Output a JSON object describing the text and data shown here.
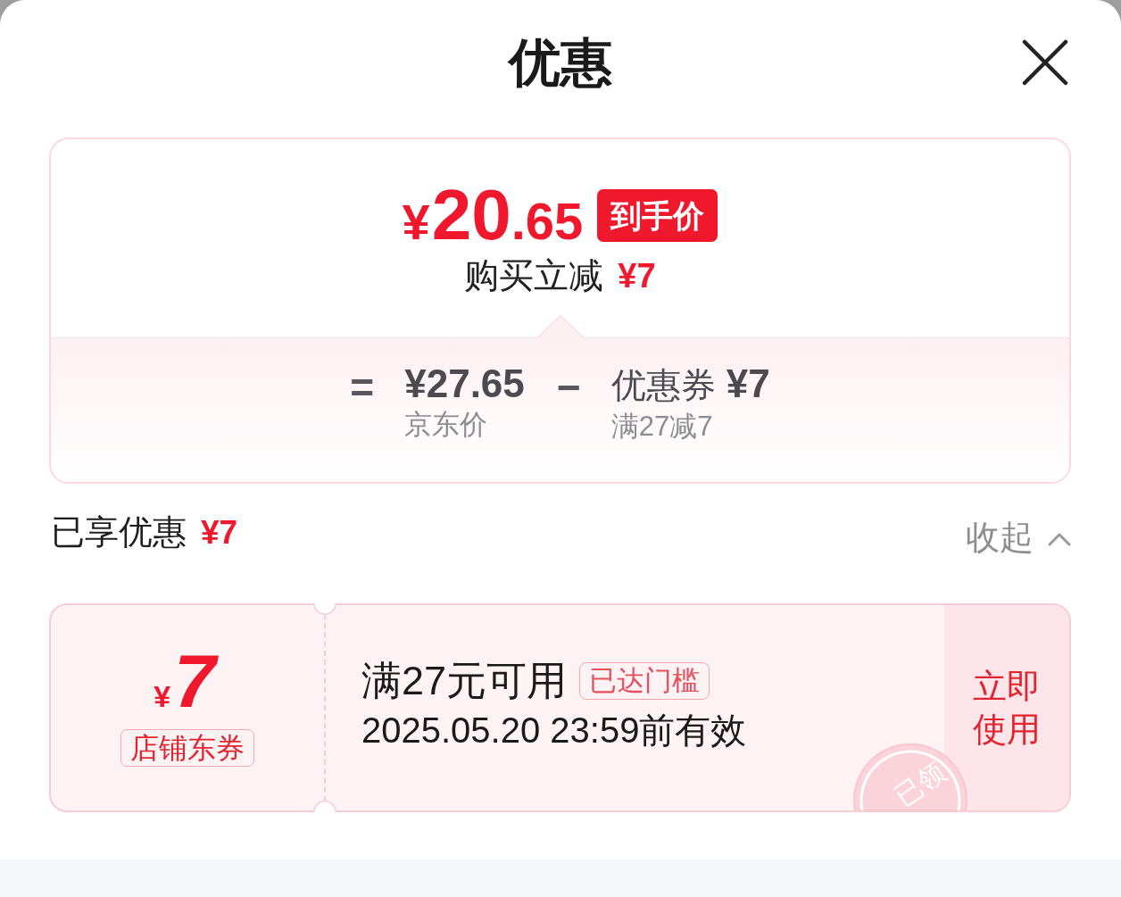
{
  "header": {
    "title": "优惠"
  },
  "price_card": {
    "final_price": {
      "currency": "¥",
      "integer": "20",
      "fraction": ".65"
    },
    "price_badge": "到手价",
    "instant_discount": {
      "label": "购买立减",
      "amount": "¥7"
    },
    "breakdown": {
      "equals_sign": "=",
      "original": {
        "amount": "¥27.65",
        "label": "京东价"
      },
      "minus_sign": "−",
      "coupon": {
        "label": "优惠券",
        "amount": "¥7",
        "condition": "满27减7"
      }
    }
  },
  "applied_discount": {
    "label": "已享优惠",
    "amount": "¥7",
    "toggle": {
      "label": "收起",
      "expanded": true
    }
  },
  "coupons": [
    {
      "currency": "¥",
      "amount": "7",
      "type": "店铺东券",
      "condition": "满27元可用",
      "threshold_tag": "已达门槛",
      "validity": "2025.05.20 23:59前有效",
      "action": "立即使用",
      "stamp": "已领"
    }
  ]
}
